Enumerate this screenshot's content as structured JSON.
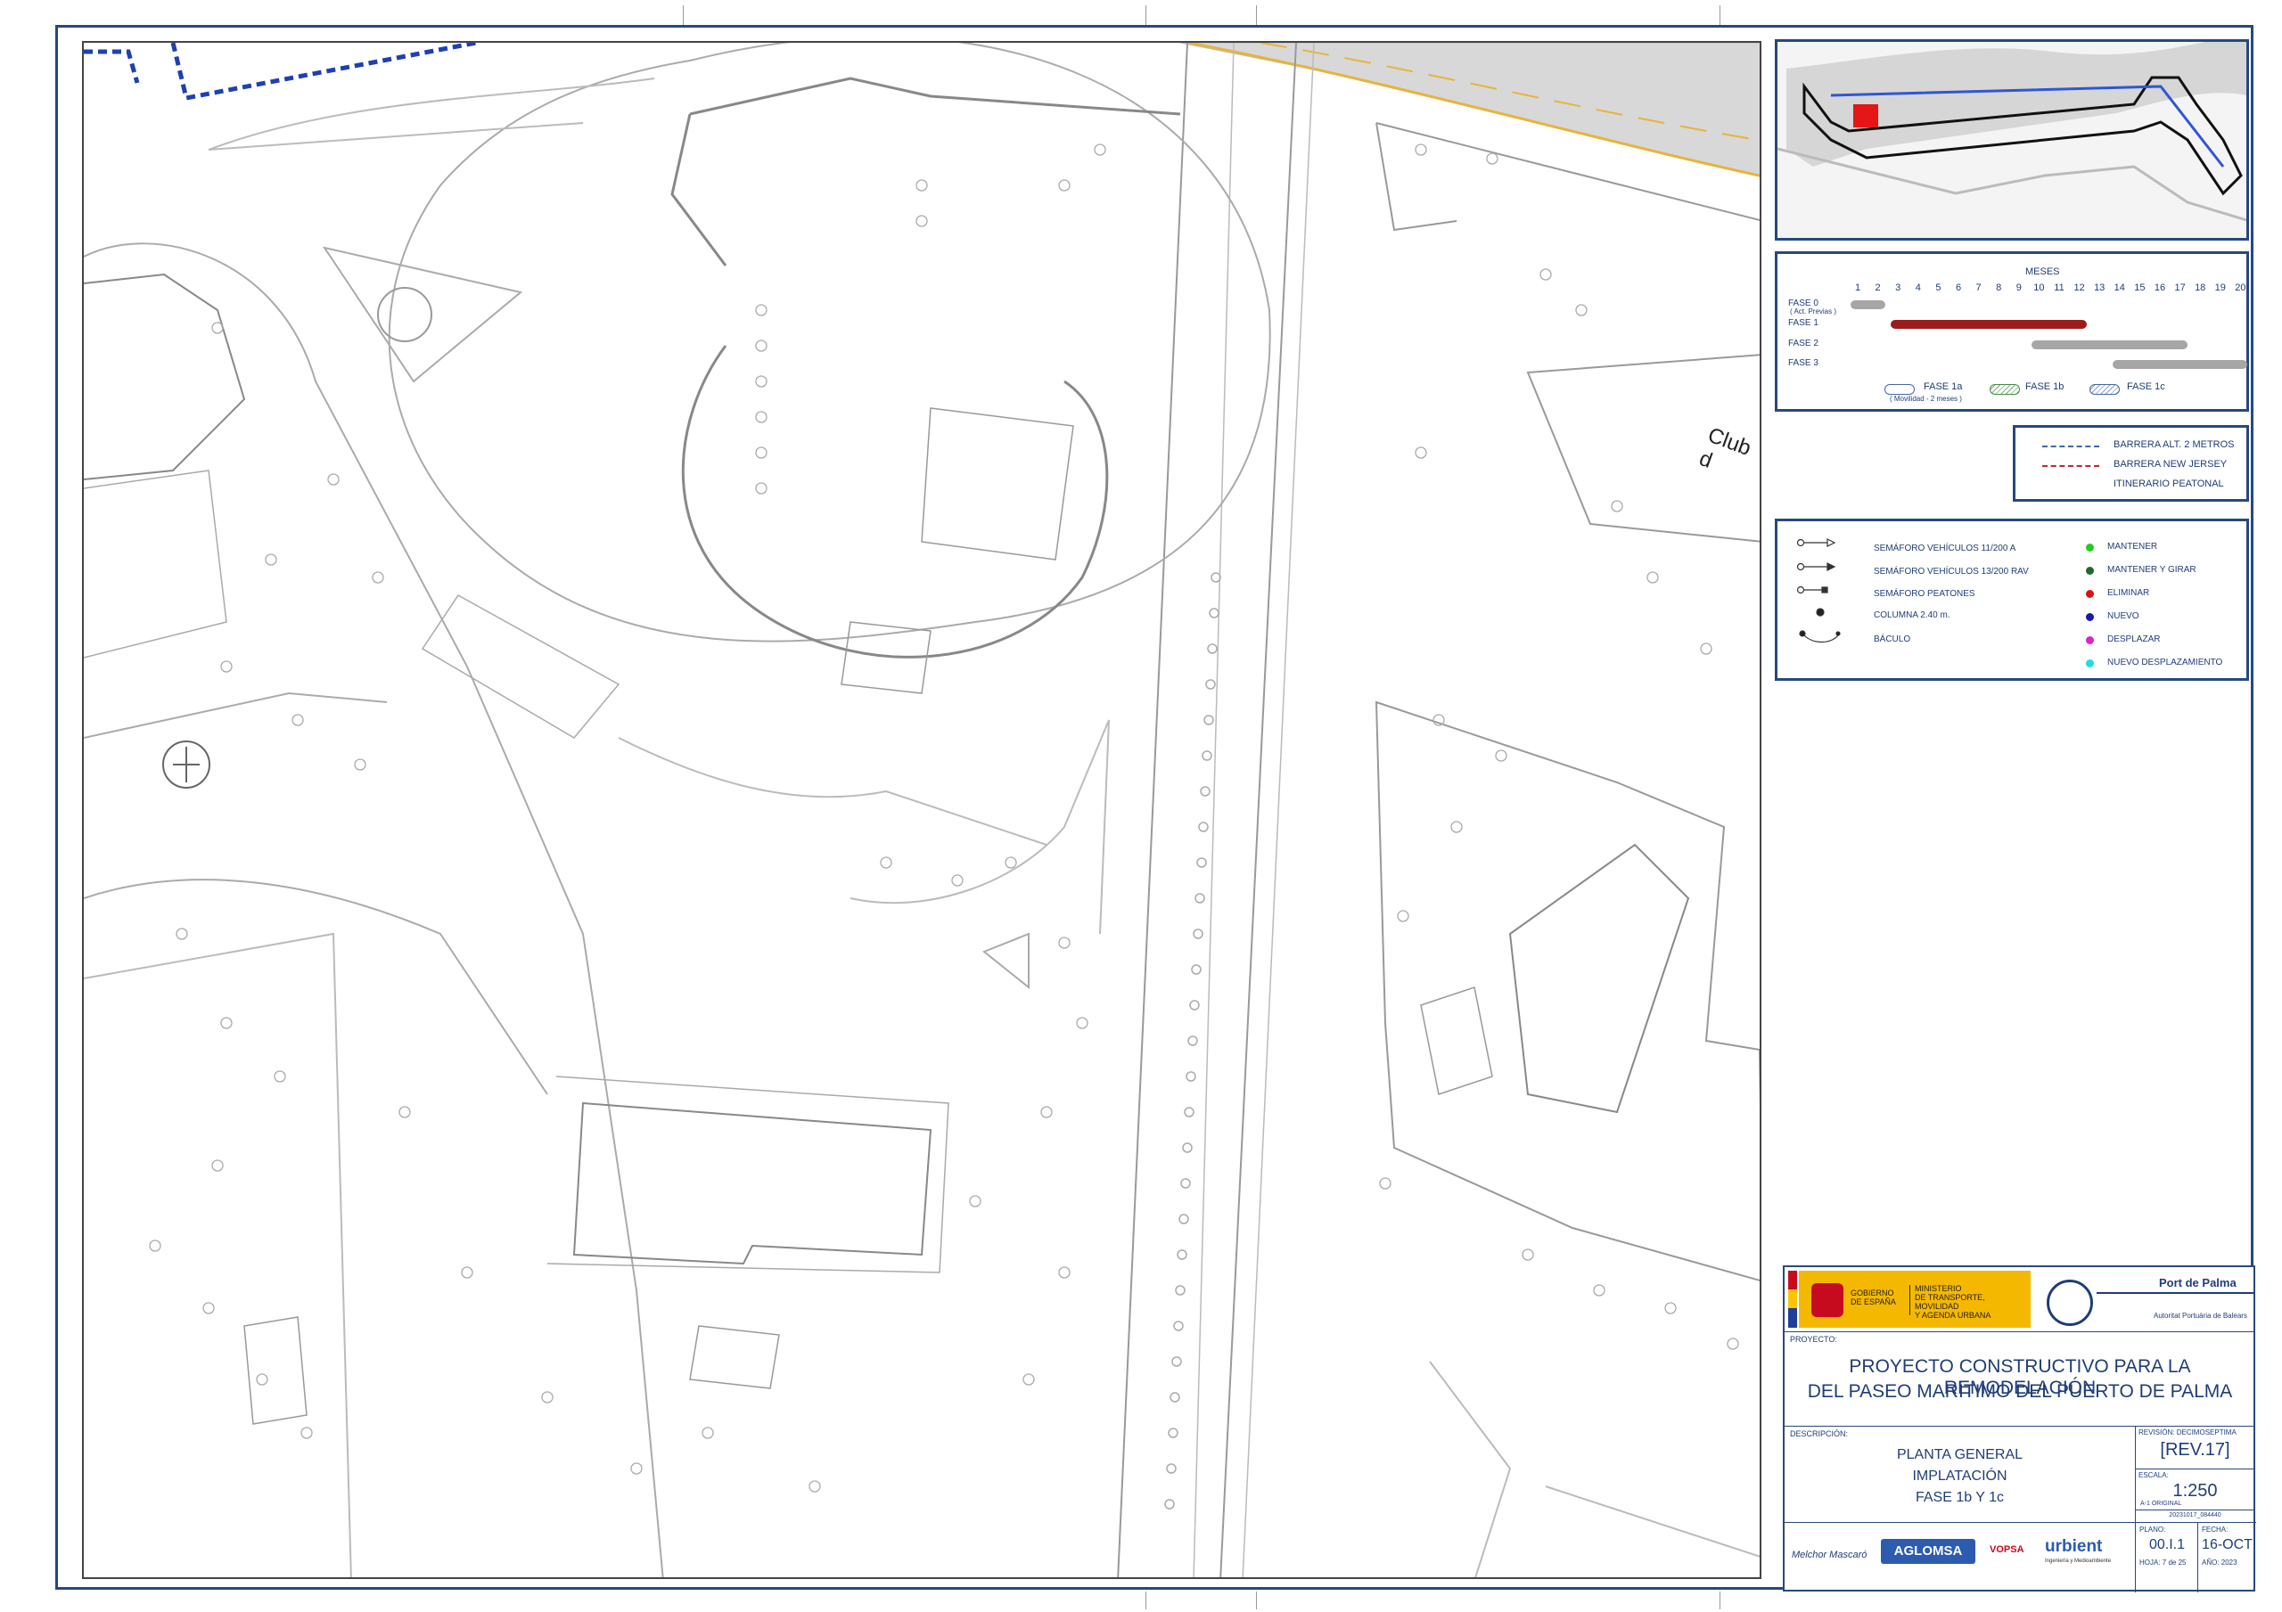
{
  "map": {
    "label_club": "Club d"
  },
  "schedule": {
    "header": "MESES",
    "months": [
      "1",
      "2",
      "3",
      "4",
      "5",
      "6",
      "7",
      "8",
      "9",
      "10",
      "11",
      "12",
      "13",
      "14",
      "15",
      "16",
      "17",
      "18",
      "19",
      "20"
    ],
    "phases": [
      {
        "name": "FASE 0",
        "sub": "( Act. Previas )",
        "start": 1,
        "end": 2,
        "color": "#a6a6a6"
      },
      {
        "name": "FASE 1",
        "sub": "",
        "start": 3,
        "end": 12,
        "color": "#9b1c1c"
      },
      {
        "name": "FASE 2",
        "sub": "",
        "start": 10,
        "end": 17,
        "color": "#a6a6a6"
      },
      {
        "name": "FASE 3",
        "sub": "",
        "start": 14,
        "end": 20,
        "color": "#a6a6a6"
      }
    ],
    "subphase_legend": [
      {
        "label": "FASE 1a",
        "sub": "( Movilidad - 2 meses )"
      },
      {
        "label": "FASE 1b",
        "sub": ""
      },
      {
        "label": "FASE 1c",
        "sub": ""
      }
    ]
  },
  "barriers": [
    {
      "label": "BARRERA ALT. 2 METROS",
      "color": "#3f66b0"
    },
    {
      "label": "BARRERA NEW JERSEY",
      "color": "#b03030"
    },
    {
      "label": "ITINERARIO  PEATONAL",
      "color": ""
    }
  ],
  "symbols": {
    "left": [
      {
        "icon": "semaforo-vehiculos-a-icon",
        "label": "SEMÁFORO VEHÍCULOS 11/200 A"
      },
      {
        "icon": "semaforo-vehiculos-rav-icon",
        "label": "SEMÁFORO VEHÍCULOS 13/200 RAV"
      },
      {
        "icon": "semaforo-peatones-icon",
        "label": "SEMÁFORO PEATONES"
      },
      {
        "icon": "columna-icon",
        "label": "COLUMNA 2.40 m."
      },
      {
        "icon": "baculo-icon",
        "label": "BÁCULO"
      }
    ],
    "right": [
      {
        "color": "#22cc22",
        "label": "MANTENER"
      },
      {
        "color": "#1e6b2d",
        "label": "MANTENER Y GIRAR"
      },
      {
        "color": "#dd1111",
        "label": "ELIMINAR"
      },
      {
        "color": "#1a1aaa",
        "label": "NUEVO"
      },
      {
        "color": "#dd22cc",
        "label": "DESPLAZAR"
      },
      {
        "color": "#22dddd",
        "label": "NUEVO DESPLAZAMIENTO"
      }
    ]
  },
  "title_block": {
    "gobierno": "GOBIERNO\nDE ESPAÑA",
    "ministerio": "MINISTERIO\nDE TRANSPORTE, MOVILIDAD\nY AGENDA URBANA",
    "port_title": "Port de Palma",
    "port_sub": "Autoritat Portuària de Balears",
    "proyecto_label": "PROYECTO:",
    "proyecto_line1": "PROYECTO CONSTRUCTIVO PARA LA REMODELACIÓN",
    "proyecto_line2": "DEL PASEO MARÍTIMO DEL PUERTO DE PALMA",
    "descripcion_label": "DESCRIPCIÓN:",
    "desc_line1": "PLANTA GENERAL",
    "desc_line2": "IMPLATACIÓN",
    "desc_line3": "FASE 1b Y 1c",
    "revision_label": "REVISIÓN:",
    "revision_word": "DECIMOSEPTIMA",
    "revision_value": "[REV.17]",
    "escala_label": "ESCALA:",
    "escala_value": "1:250",
    "escala_note": "A-1 ORIGINAL",
    "file_code": "20231017_084440",
    "plano_label": "PLANO:",
    "plano_value": "00.I.1",
    "hoja": "HOJA: 7 de 25",
    "fecha_label": "FECHA:",
    "fecha_value": "16-OCT",
    "anio": "AÑO: 2023",
    "company1": "Melchor Mascaró",
    "company2": "AGLOMSA",
    "company3": "VOPSA",
    "company4": "urbient",
    "company4_sub": "Ingeniería y Medioambiente"
  }
}
